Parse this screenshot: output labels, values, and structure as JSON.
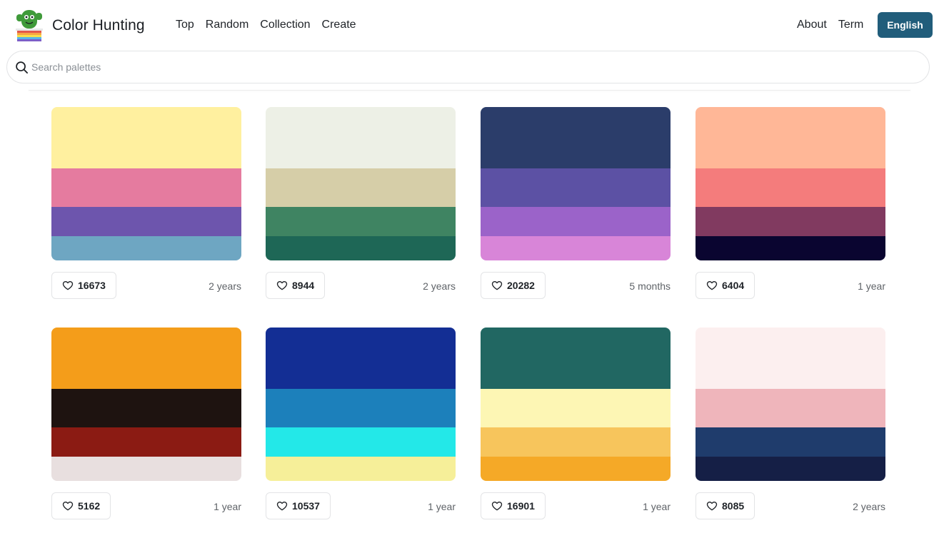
{
  "brand": {
    "name": "Color Hunting",
    "logo_icon": "cactus-logo-icon"
  },
  "nav": {
    "items": [
      "Top",
      "Random",
      "Collection",
      "Create"
    ]
  },
  "right_nav": {
    "items": [
      "About",
      "Term"
    ],
    "language_button": "English"
  },
  "search": {
    "placeholder": "Search palettes",
    "icon": "search-icon"
  },
  "colors": {
    "accent": "#215d7b"
  },
  "palettes": [
    {
      "colors": [
        "#fff09f",
        "#e57b9f",
        "#6d55ad",
        "#6ea6c2"
      ],
      "likes": "16673",
      "age": "2 years"
    },
    {
      "colors": [
        "#edf0e6",
        "#d6cea8",
        "#3f8462",
        "#1e6756"
      ],
      "likes": "8944",
      "age": "2 years"
    },
    {
      "colors": [
        "#2b3d6a",
        "#5c51a4",
        "#9b63c9",
        "#d885d8"
      ],
      "likes": "20282",
      "age": "5 months"
    },
    {
      "colors": [
        "#ffb797",
        "#f47c7c",
        "#813a60",
        "#0a0530"
      ],
      "likes": "6404",
      "age": "1 year"
    },
    {
      "colors": [
        "#f49d1a",
        "#1e1310",
        "#8b1b13",
        "#e8dfdf"
      ],
      "likes": "5162",
      "age": "1 year"
    },
    {
      "colors": [
        "#132e94",
        "#1c80bb",
        "#23e8e8",
        "#f6ef99"
      ],
      "likes": "10537",
      "age": "1 year"
    },
    {
      "colors": [
        "#216762",
        "#fdf6b4",
        "#f7c55c",
        "#f5a927"
      ],
      "likes": "16901",
      "age": "1 year"
    },
    {
      "colors": [
        "#fcefef",
        "#efb5bb",
        "#1f3c6c",
        "#151f46"
      ],
      "likes": "8085",
      "age": "2 years"
    }
  ]
}
